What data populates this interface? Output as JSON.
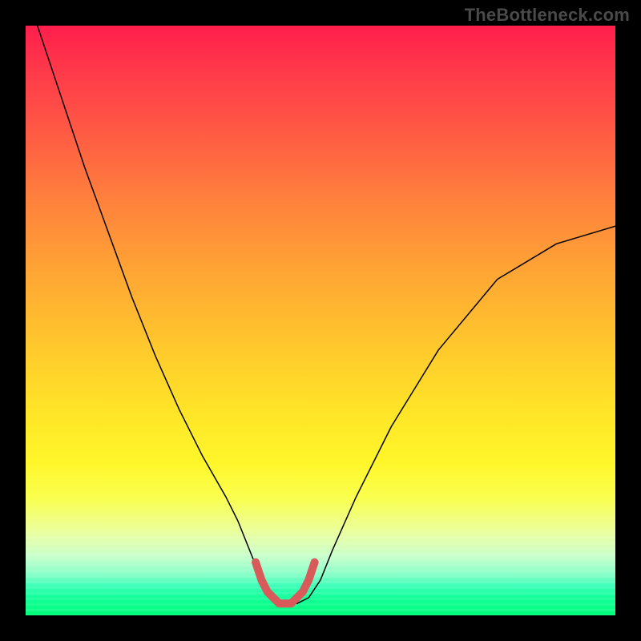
{
  "watermark": "TheBottleneck.com",
  "chart_data": {
    "type": "line",
    "title": "",
    "xlabel": "",
    "ylabel": "",
    "xlim": [
      0,
      100
    ],
    "ylim": [
      0,
      100
    ],
    "series": [
      {
        "name": "bottleneck-curve",
        "x": [
          2,
          6,
          10,
          14,
          18,
          22,
          26,
          30,
          34,
          36,
          38,
          40,
          42,
          43,
          44,
          46,
          48,
          50,
          52,
          56,
          62,
          70,
          80,
          90,
          100
        ],
        "y": [
          100,
          88,
          76,
          65,
          54,
          44,
          35,
          27,
          20,
          16,
          11,
          6,
          3,
          2,
          2,
          2,
          3,
          6,
          11,
          20,
          32,
          45,
          57,
          63,
          66
        ],
        "stroke": "#000000",
        "stroke_width": 1.5
      },
      {
        "name": "valley-highlight",
        "x": [
          39,
          40,
          41,
          42,
          43,
          44,
          45,
          46,
          47,
          48,
          49
        ],
        "y": [
          9,
          6,
          4,
          3,
          2,
          2,
          2,
          3,
          4,
          6,
          9
        ],
        "stroke": "#d85a5a",
        "stroke_width": 10
      }
    ],
    "annotations": []
  },
  "colors": {
    "background_black": "#000000",
    "watermark_grey": "#4a4a4a",
    "curve_black": "#000000",
    "valley_salmon": "#d85a5a",
    "gradient_top_red": "#ff1e4c",
    "gradient_mid_yellow": "#ffe628",
    "gradient_bottom_green": "#00ff7a"
  }
}
